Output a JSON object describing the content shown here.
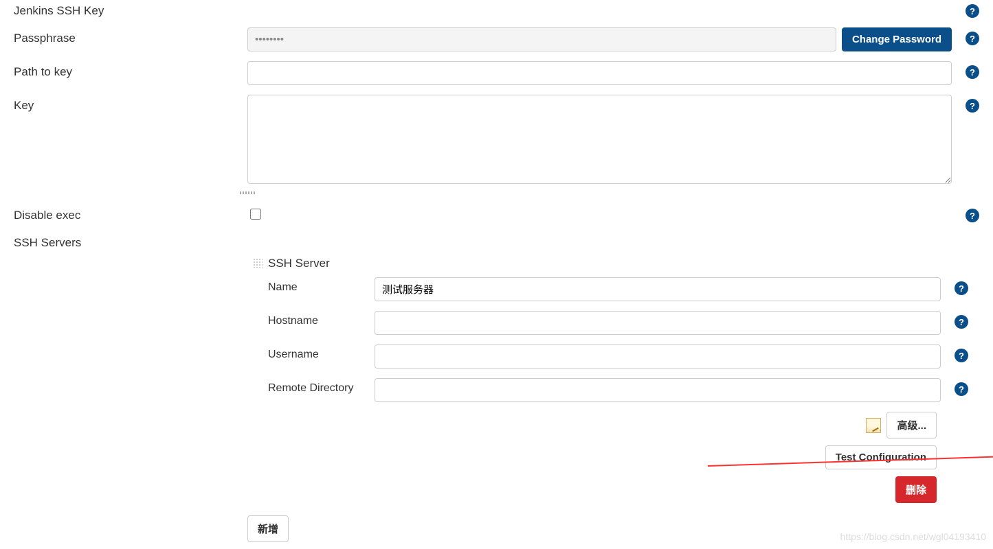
{
  "sectionTitle": "Jenkins SSH Key",
  "labels": {
    "passphrase": "Passphrase",
    "pathToKey": "Path to key",
    "key": "Key",
    "disableExec": "Disable exec",
    "sshServers": "SSH Servers",
    "sshServer": "SSH Server",
    "name": "Name",
    "hostname": "Hostname",
    "username": "Username",
    "remoteDirectory": "Remote Directory"
  },
  "values": {
    "passphrase": "••••••••",
    "pathToKey": "",
    "key": "",
    "disableExec": false,
    "server": {
      "name": "测试服务器",
      "hostname": "",
      "username": "",
      "remoteDirectory": ""
    }
  },
  "buttons": {
    "changePassword": "Change Password",
    "advanced": "高级...",
    "testConfiguration": "Test Configuration",
    "delete": "删除",
    "add": "新增"
  },
  "watermark": "https://blog.csdn.net/wgl04193410",
  "colors": {
    "primary": "#0b4f8a",
    "danger": "#d6282c",
    "annotation": "#ff3030"
  }
}
